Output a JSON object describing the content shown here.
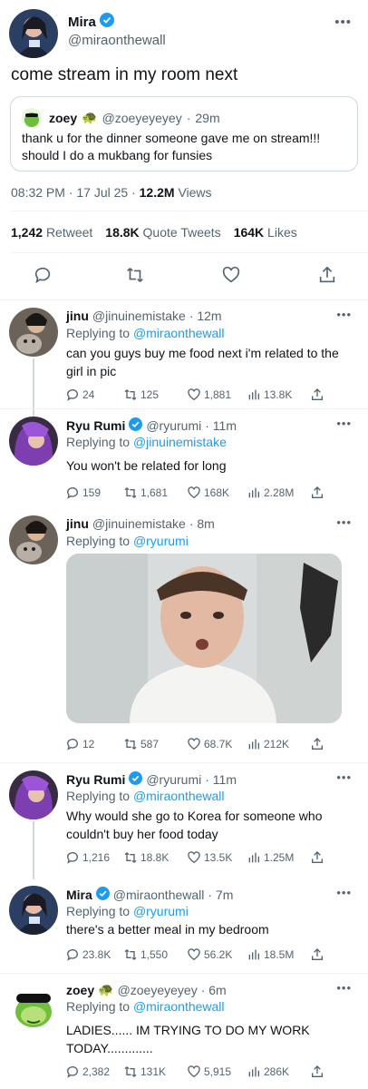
{
  "main_tweet": {
    "display_name": "Mira",
    "handle": "@miraonthewall",
    "text": "come stream in my room next",
    "quoted": {
      "display_name": "zoey",
      "handle": "@zoeyeyeyey",
      "time": "29m",
      "text": "thank u for the dinner someone gave me on stream!!! should I do a mukbang for funsies"
    },
    "timestamp": "08:32 PM · 17 Jul 25 · ",
    "views_count": "12.2M",
    "views_label": " Views",
    "stats": {
      "retweets_count": "1,242",
      "retweets_label": "Retweet",
      "quotes_count": "18.8K",
      "quotes_label": "Quote Tweets",
      "likes_count": "164K",
      "likes_label": "Likes"
    },
    "more": "•••"
  },
  "replies": [
    {
      "display_name": "jinu",
      "handle": "@jinuinemistake",
      "time": "· 12m",
      "replying_prefix": "Replying to ",
      "replying_to": "@miraonthewall",
      "text": "can you guys buy me food next i'm related to the girl in pic",
      "replies": "24",
      "retweets": "125",
      "likes": "1,881",
      "views": "13.8K"
    },
    {
      "display_name": "Ryu Rumi",
      "handle": "@ryurumi",
      "time": "· 11m",
      "replying_prefix": "Replying to ",
      "replying_to": "@jinuinemistake",
      "text": "You won't be related for long",
      "replies": "159",
      "retweets": "1,681",
      "likes": "168K",
      "views": "2.28M"
    },
    {
      "display_name": "jinu",
      "handle": "@jinuinemistake",
      "time": "· 8m",
      "replying_prefix": "Replying to ",
      "replying_to": "@ryurumi",
      "text": "",
      "replies": "12",
      "retweets": "587",
      "likes": "68.7K",
      "views": "212K"
    },
    {
      "display_name": "Ryu Rumi",
      "handle": "@ryurumi",
      "time": "· 11m",
      "replying_prefix": "Replying to ",
      "replying_to": "@miraonthewall",
      "text": "Why would she go to Korea for someone who couldn't buy her food today",
      "replies": "1,216",
      "retweets": "18.8K",
      "likes": "13.5K",
      "views": "1.25M"
    },
    {
      "display_name": "Mira",
      "handle": "@miraonthewall",
      "time": "· 7m",
      "replying_prefix": "Replying to ",
      "replying_to": "@ryurumi",
      "text": "there's a better meal in my bedroom",
      "replies": "23.8K",
      "retweets": "1,550",
      "likes": "56.2K",
      "views": "18.5M"
    },
    {
      "display_name": "zoey",
      "handle": "@zoeyeyeyey",
      "time": "· 6m",
      "replying_prefix": "Replying to ",
      "replying_to": "@miraonthewall",
      "text": "LADIES...... IM TRYING TO DO MY WORK TODAY.............",
      "replies": "2,382",
      "retweets": "131K",
      "likes": "5,915",
      "views": "286K"
    }
  ],
  "more_icon": "•••",
  "colors": {
    "accent": "#1d9bf0",
    "muted": "#536471",
    "text": "#0f1419"
  }
}
